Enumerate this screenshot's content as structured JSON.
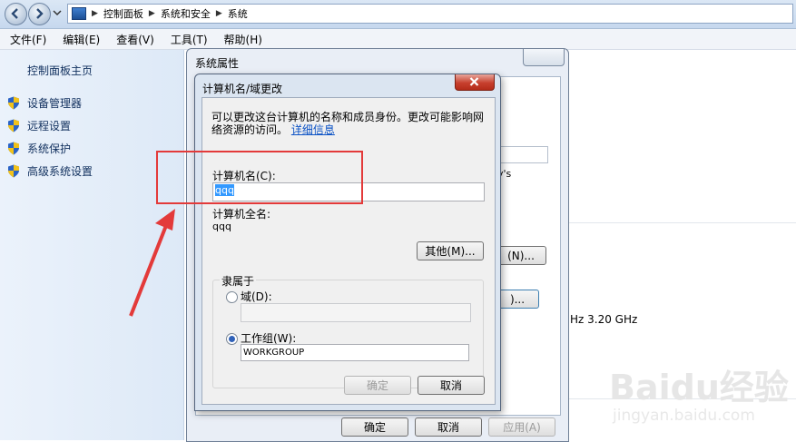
{
  "window": {
    "breadcrumbs": [
      "控制面板",
      "系统和安全",
      "系统"
    ],
    "menu": [
      "文件(F)",
      "编辑(E)",
      "查看(V)",
      "工具(T)",
      "帮助(H)"
    ]
  },
  "left_pane": {
    "home_link": "控制面板主页",
    "items": [
      {
        "label": "设备管理器",
        "icon": "shield-icon"
      },
      {
        "label": "远程设置",
        "icon": "shield-icon"
      },
      {
        "label": "系统保护",
        "icon": "shield-icon"
      },
      {
        "label": "高级系统设置",
        "icon": "shield-icon"
      }
    ]
  },
  "background": {
    "cpu_text": "Hz   3.20 GHz",
    "partial_text_1": "y's",
    "partial_button_1": "(N)...",
    "partial_button_2": ")..."
  },
  "system_properties": {
    "title": "系统属性",
    "ok_label": "确定",
    "cancel_label": "取消",
    "apply_label": "应用(A)"
  },
  "computer_name_dialog": {
    "title": "计算机名/域更改",
    "intro": "可以更改这台计算机的名称和成员身份。更改可能影响网络资源的访问。",
    "details_link": "详细信息",
    "computer_name_label": "计算机名(C):",
    "computer_name_value": "qqq",
    "full_name_label": "计算机全名:",
    "full_name_value": "qqq",
    "more_button": "其他(M)...",
    "member_of_label": "隶属于",
    "domain_label": "域(D):",
    "domain_value": "",
    "workgroup_label": "工作组(W):",
    "workgroup_value": "WORKGROUP",
    "selected_membership": "workgroup",
    "ok_label": "确定",
    "cancel_label": "取消"
  },
  "watermark": {
    "brand": "Baidu经验",
    "url": "jingyan.baidu.com"
  },
  "colors": {
    "annotation_red": "#e33a3a",
    "link_blue": "#0b52c5",
    "selection_blue": "#3399ff"
  }
}
